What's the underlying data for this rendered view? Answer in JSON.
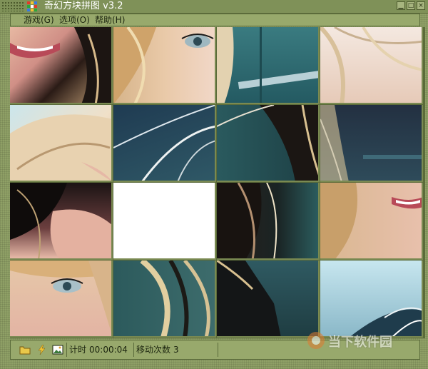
{
  "window": {
    "title": "奇幻方块拼图 v3.2"
  },
  "menu": [
    {
      "label": "游戏(G)"
    },
    {
      "label": "选项(O)"
    },
    {
      "label": "帮助(H)"
    }
  ],
  "board": {
    "rows": 4,
    "cols": 4,
    "blank_tile": {
      "row": 3,
      "col": 2
    },
    "tiles": [
      {
        "name": "tile-r1c1",
        "desc": "lips and hair",
        "bg": "#c89a88"
      },
      {
        "name": "tile-r1c2",
        "desc": "eye and blonde hair",
        "bg": "#d4bfa6"
      },
      {
        "name": "tile-r1c3",
        "desc": "hair on teal background",
        "bg": "#2d6a72"
      },
      {
        "name": "tile-r1c4",
        "desc": "blonde hair on skin",
        "bg": "#e8d0c0"
      },
      {
        "name": "tile-r2c1",
        "desc": "blonde hair on cyan sky",
        "bg": "#b8d8e0"
      },
      {
        "name": "tile-r2c2",
        "desc": "hair strands on dark teal",
        "bg": "#2b4a5a"
      },
      {
        "name": "tile-r2c3",
        "desc": "dark hair on teal",
        "bg": "#274c4e"
      },
      {
        "name": "tile-r2c4",
        "desc": "hair strands on dark",
        "bg": "#2c3f50"
      },
      {
        "name": "tile-r3c1",
        "desc": "dark hair and skin",
        "bg": "#6a4a4a"
      },
      {
        "name": "tile-r3c2",
        "desc": "empty slot",
        "bg": "#ffffff"
      },
      {
        "name": "tile-r3c3",
        "desc": "dark hair on teal",
        "bg": "#2a3230"
      },
      {
        "name": "tile-r3c4",
        "desc": "mouth and hair",
        "bg": "#c8a090"
      },
      {
        "name": "tile-r4c1",
        "desc": "eye and blonde hair",
        "bg": "#d8b8a8"
      },
      {
        "name": "tile-r4c2",
        "desc": "blonde strands on teal",
        "bg": "#496a6a"
      },
      {
        "name": "tile-r4c3",
        "desc": "black shoulder on teal",
        "bg": "#1f2a2a"
      },
      {
        "name": "tile-r4c4",
        "desc": "hair strands on sky",
        "bg": "#9cc8d8"
      }
    ]
  },
  "status": {
    "timer_label": "计时",
    "timer_value": "00:00:04",
    "moves_label": "移动次数",
    "moves_value": "3"
  },
  "watermark": "当下软件园"
}
